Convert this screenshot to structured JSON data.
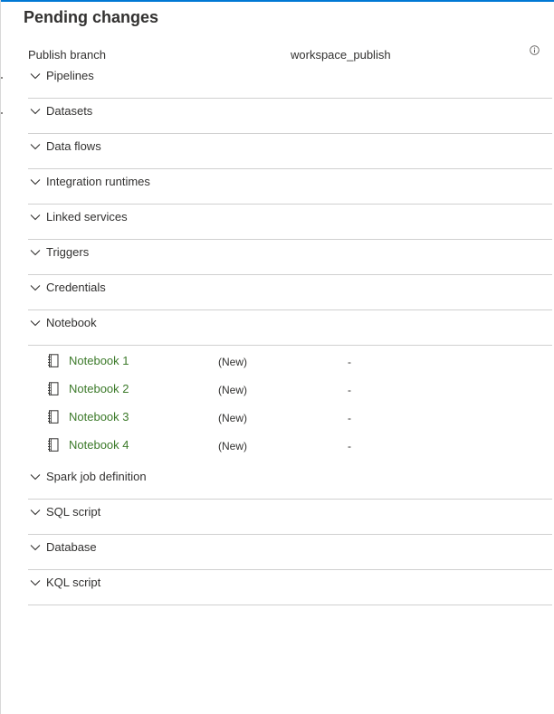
{
  "panel": {
    "title": "Pending changes",
    "accent_color": "#0078d4",
    "publish_branch_label": "Publish branch",
    "publish_branch_value": "workspace_publish",
    "info_icon": "info-circle-icon"
  },
  "sections": [
    {
      "label": "Pipelines",
      "expanded": false
    },
    {
      "label": "Datasets",
      "expanded": false
    },
    {
      "label": "Data flows",
      "expanded": false
    },
    {
      "label": "Integration runtimes",
      "expanded": false
    },
    {
      "label": "Linked services",
      "expanded": false
    },
    {
      "label": "Triggers",
      "expanded": false
    },
    {
      "label": "Credentials",
      "expanded": false
    },
    {
      "label": "Notebook",
      "expanded": true,
      "items": [
        {
          "name": "Notebook 1",
          "status": "(New)",
          "extra": "-"
        },
        {
          "name": "Notebook 2",
          "status": "(New)",
          "extra": "-"
        },
        {
          "name": "Notebook 3",
          "status": "(New)",
          "extra": "-"
        },
        {
          "name": "Notebook 4",
          "status": "(New)",
          "extra": "-"
        }
      ]
    },
    {
      "label": "Spark job definition",
      "expanded": false
    },
    {
      "label": "SQL script",
      "expanded": false
    },
    {
      "label": "Database",
      "expanded": false
    },
    {
      "label": "KQL script",
      "expanded": false
    }
  ],
  "icons": {
    "chevron": "chevron-down-icon",
    "notebook": "notebook-icon"
  },
  "colors": {
    "item_link": "#3c7a2a",
    "divider": "#d0d0d0"
  }
}
